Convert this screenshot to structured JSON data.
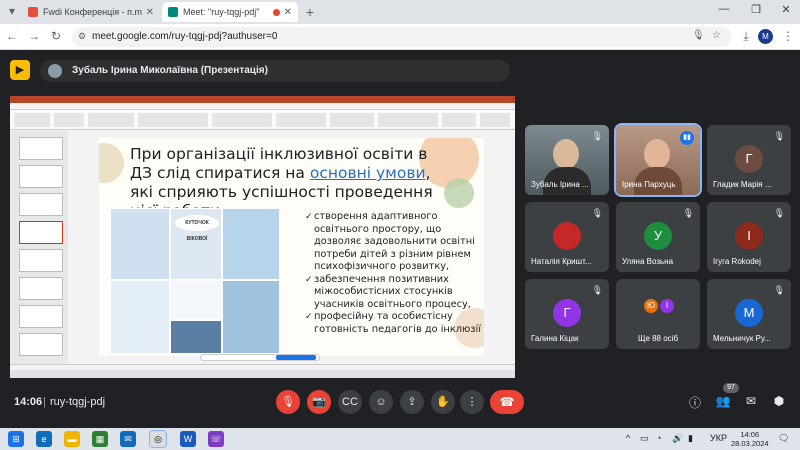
{
  "browser": {
    "tabs": [
      {
        "title": "Fwdi Конференція - п.melnych",
        "active": false,
        "favicon_color": "#e84e40"
      },
      {
        "title": "Meet: \"ruy-tqgj-pdj\"",
        "active": true,
        "favicon_color": "#00897b"
      }
    ],
    "url": "meet.google.com/ruy-tqgj-pdj?authuser=0"
  },
  "meet": {
    "presenter_title": "Зубаль Ірина Миколаївна (Презентація)",
    "time": "14:06",
    "meeting_code": "ruy-tqgj-pdj",
    "participants_badge": "97",
    "participants": [
      {
        "name": "Зубаль Ірина ...",
        "type": "video",
        "muted": true
      },
      {
        "name": "Ірина Пархуць",
        "type": "video",
        "speaking": true
      },
      {
        "name": "Гладик Марія ...",
        "type": "avatar",
        "initial": "Г",
        "color": "#6d4c41",
        "muted": true
      },
      {
        "name": "Наталія Кришт...",
        "type": "photo",
        "muted": true
      },
      {
        "name": "Уляна Возьна",
        "type": "avatar",
        "initial": "У",
        "color": "#1e8e3e",
        "muted": true
      },
      {
        "name": "Ігуга Rokodej",
        "type": "avatar",
        "initial": "І",
        "color": "#8e2a1b",
        "muted": true
      },
      {
        "name": "Галина Кіцак",
        "type": "avatar",
        "initial": "Г",
        "color": "#9334e6",
        "muted": true
      },
      {
        "name": "Ще 88 осіб",
        "type": "more",
        "initials": [
          "Ю",
          "І"
        ]
      },
      {
        "name": "Мельничук Ру...",
        "type": "avatar",
        "initial": "М",
        "color": "#1967d2",
        "muted": true
      }
    ]
  },
  "slide": {
    "title_before": "При організації інклюзивної освіти в ДЗ слід спиратися на ",
    "title_highlight": "основні умови",
    "title_after": ", які сприяють успішності проведення цієї роботи:",
    "bullets": [
      "створення адаптивного освітнього простору, що дозволяє задовольнити освітні потреби дітей з різним рівнем психофізичного розвитку,",
      "забезпечення позитивних міжособистісних стосунків учасників освітнього процесу,",
      "професійну та особистісну готовність педагогів до інклюзії"
    ],
    "photo_label": "КУТОЧОК ВІКОВОЇ"
  },
  "taskbar": {
    "lang": "УКР",
    "time": "14:06",
    "date": "28.03.2024"
  }
}
